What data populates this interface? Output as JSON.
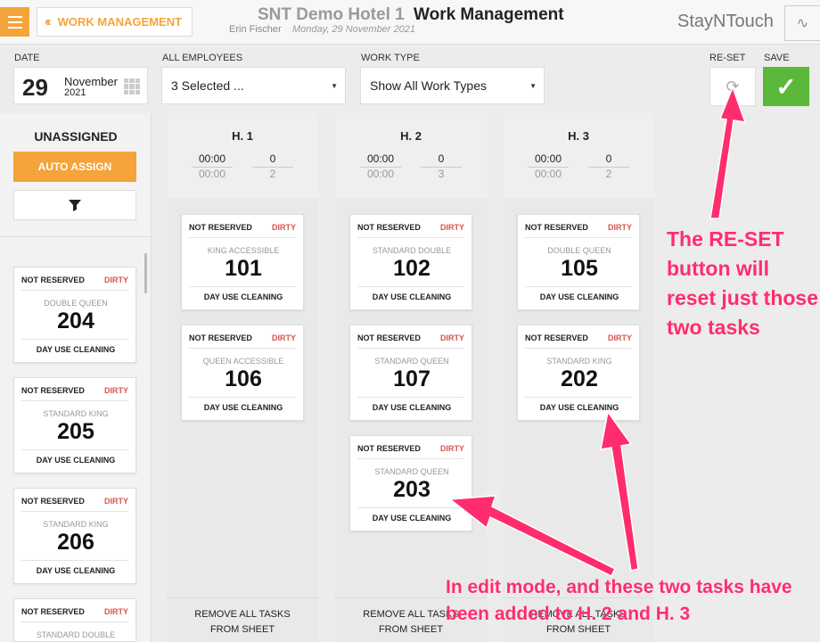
{
  "header": {
    "back_label": "WORK MANAGEMENT",
    "hotel": "SNT Demo Hotel 1",
    "title": "Work Management",
    "user": "Erin Fischer",
    "date": "Monday, 29 November 2021",
    "brand": "StayNTouch"
  },
  "filters": {
    "date_label": "DATE",
    "date_day": "29",
    "date_month": "November",
    "date_year": "2021",
    "employees_label": "ALL EMPLOYEES",
    "employees_value": "3 Selected ...",
    "worktype_label": "WORK TYPE",
    "worktype_value": "Show All Work Types",
    "reset_label": "RE-SET",
    "save_label": "SAVE"
  },
  "left": {
    "title": "UNASSIGNED",
    "auto_assign": "AUTO ASSIGN",
    "cards": [
      {
        "status": "NOT RESERVED",
        "cond": "DIRTY",
        "type": "DOUBLE QUEEN",
        "room": "204",
        "task": "DAY USE CLEANING"
      },
      {
        "status": "NOT RESERVED",
        "cond": "DIRTY",
        "type": "STANDARD KING",
        "room": "205",
        "task": "DAY USE CLEANING"
      },
      {
        "status": "NOT RESERVED",
        "cond": "DIRTY",
        "type": "STANDARD KING",
        "room": "206",
        "task": "DAY USE CLEANING"
      },
      {
        "status": "NOT RESERVED",
        "cond": "DIRTY",
        "type": "STANDARD DOUBLE",
        "room": "",
        "task": ""
      }
    ]
  },
  "columns": [
    {
      "name": "H. 1",
      "time1": "00:00",
      "time2": "00:00",
      "count1": "0",
      "count2": "2",
      "footer1": "REMOVE ALL TASKS",
      "footer2": "FROM SHEET",
      "cards": [
        {
          "status": "NOT RESERVED",
          "cond": "DIRTY",
          "type": "KING ACCESSIBLE",
          "room": "101",
          "task": "DAY USE CLEANING"
        },
        {
          "status": "NOT RESERVED",
          "cond": "DIRTY",
          "type": "QUEEN ACCESSIBLE",
          "room": "106",
          "task": "DAY USE CLEANING"
        }
      ]
    },
    {
      "name": "H. 2",
      "time1": "00:00",
      "time2": "00:00",
      "count1": "0",
      "count2": "3",
      "footer1": "REMOVE ALL TASKS",
      "footer2": "FROM SHEET",
      "cards": [
        {
          "status": "NOT RESERVED",
          "cond": "DIRTY",
          "type": "STANDARD DOUBLE",
          "room": "102",
          "task": "DAY USE CLEANING"
        },
        {
          "status": "NOT RESERVED",
          "cond": "DIRTY",
          "type": "STANDARD QUEEN",
          "room": "107",
          "task": "DAY USE CLEANING"
        },
        {
          "status": "NOT RESERVED",
          "cond": "DIRTY",
          "type": "STANDARD QUEEN",
          "room": "203",
          "task": "DAY USE CLEANING"
        }
      ]
    },
    {
      "name": "H. 3",
      "time1": "00:00",
      "time2": "00:00",
      "count1": "0",
      "count2": "2",
      "footer1": "REMOVE ALL TASKS",
      "footer2": "FROM SHEET",
      "cards": [
        {
          "status": "NOT RESERVED",
          "cond": "DIRTY",
          "type": "DOUBLE QUEEN",
          "room": "105",
          "task": "DAY USE CLEANING"
        },
        {
          "status": "NOT RESERVED",
          "cond": "DIRTY",
          "type": "STANDARD KING",
          "room": "202",
          "task": "DAY USE CLEANING"
        }
      ]
    }
  ],
  "annotations": {
    "reset_note": "The RE-SET button will reset just those two tasks",
    "edit_note": "In edit mode, and these two tasks have been added to H. 2 and H. 3"
  },
  "colors": {
    "accent": "#f4a43a",
    "save": "#5bb83b",
    "dirty": "#d9534f",
    "annotation": "#ff2d6d"
  }
}
